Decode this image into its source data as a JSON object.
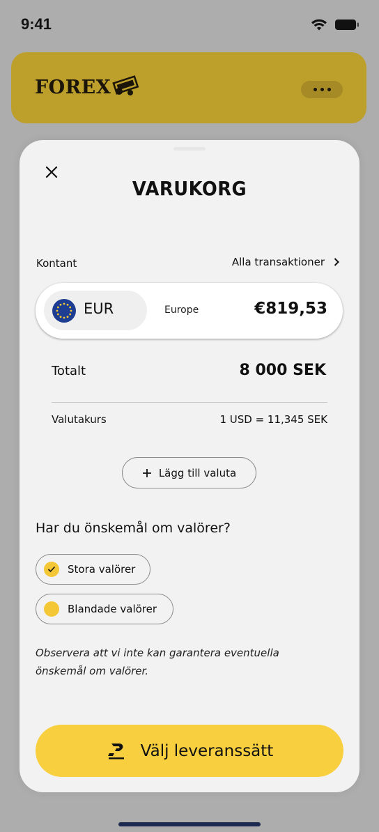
{
  "status_bar": {
    "time": "9:41"
  },
  "header": {
    "brand": "FOREX"
  },
  "sheet": {
    "title": "VARUKORG",
    "section_label": "Kontant",
    "all_transactions_label": "Alla transaktioner",
    "currency_item": {
      "code": "EUR",
      "region": "Europe",
      "amount": "€819,53"
    },
    "total_label": "Totalt",
    "total_value": "8 000 SEK",
    "rate_label": "Valutakurs",
    "rate_value": "1 USD = 11,345 SEK",
    "add_currency_label": "Lägg till valuta",
    "denomination_question": "Har du önskemål om valörer?",
    "denomination_options": [
      {
        "label": "Stora valörer",
        "selected": true
      },
      {
        "label": "Blandade valörer",
        "selected": false
      }
    ],
    "note": "Observera att vi inte kan garantera eventuella önskemål om valörer.",
    "cta_label": "Välj leveranssätt"
  },
  "colors": {
    "header_bg": "#bd9f2c",
    "accent_yellow": "#f8cf3f",
    "sheet_bg": "#f2f2f2",
    "eu_blue": "#1c3d91"
  }
}
